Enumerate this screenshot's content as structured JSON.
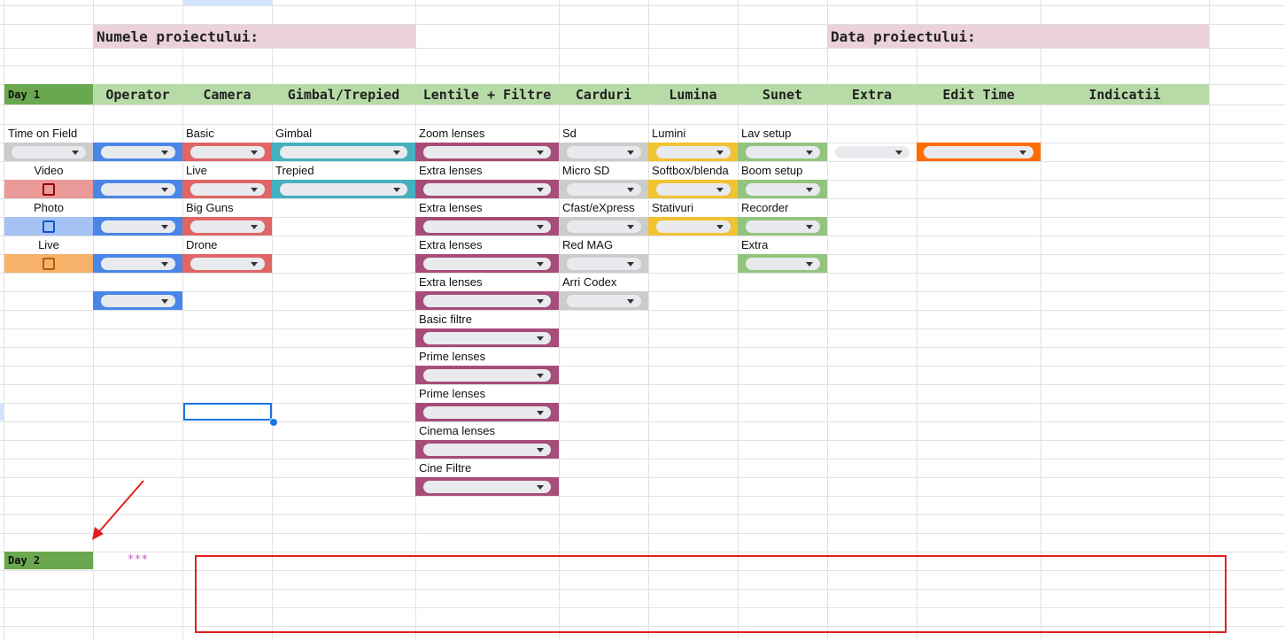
{
  "project": {
    "name_label": "Numele proiectului:",
    "date_label": "Data proiectului:"
  },
  "headers": {
    "day1": "Day 1",
    "operator": "Operator",
    "camera": "Camera",
    "gimbal": "Gimbal/Trepied",
    "lentile": "Lentile + Filtre",
    "carduri": "Carduri",
    "lumina": "Lumina",
    "sunet": "Sunet",
    "extra": "Extra",
    "edit_time": "Edit Time",
    "indicatii": "Indicatii"
  },
  "left_col": {
    "time_on_field": "Time on Field",
    "video": "Video",
    "photo": "Photo",
    "live": "Live"
  },
  "camera": [
    "Basic",
    "Live",
    "Big Guns",
    "Drone"
  ],
  "gimbal": [
    "Gimbal",
    "Trepied"
  ],
  "lentile": [
    "Zoom lenses",
    "Extra lenses",
    "Extra lenses",
    "Extra lenses",
    "Extra lenses",
    "Basic filtre",
    "Prime lenses",
    "Prime lenses",
    "Cinema lenses",
    "Cine Filtre"
  ],
  "carduri": [
    "Sd",
    "Micro SD",
    "Cfast/eXpress",
    "Red MAG",
    "Arri Codex"
  ],
  "lumina": [
    "Lumini",
    "Softbox/blenda",
    "Stativuri"
  ],
  "sunet": [
    "Lav setup",
    "Boom setup",
    "Recorder",
    "Extra"
  ],
  "day2": {
    "label": "Day 2",
    "stars": "***"
  },
  "colors": {
    "header_green": "#b7dba6",
    "day_green": "#6aa84f",
    "project_pink": "#ead1dc",
    "operator_blue": "#4a86e8",
    "camera_red": "#e06666",
    "gimbal_teal": "#45b0c0",
    "lentile_purple": "#a64d79",
    "carduri_gray": "#cccccc",
    "lumina_yellow": "#f1c232",
    "sunet_green": "#93c47d",
    "edit_orange": "#ff6d01",
    "annotation_red": "#e02020"
  }
}
